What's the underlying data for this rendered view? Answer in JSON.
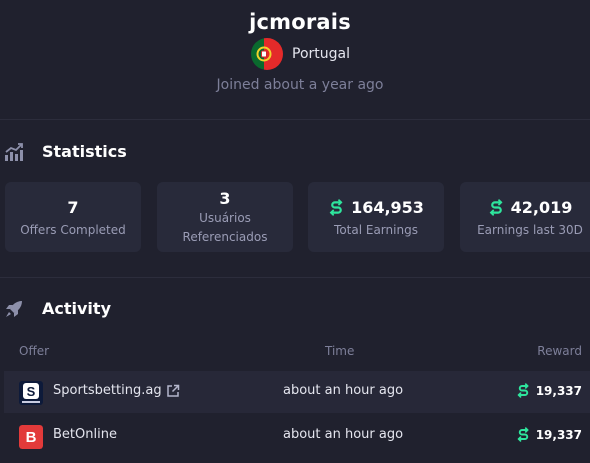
{
  "profile": {
    "username": "jcmorais",
    "country": "Portugal",
    "flag_icon": "portugal-flag-icon",
    "joined": "Joined about a year ago"
  },
  "statistics": {
    "title": "Statistics",
    "icon": "chart-trend-icon",
    "cards": [
      {
        "value": "7",
        "label": "Offers Completed"
      },
      {
        "value": "3",
        "label_line1": "Usuários",
        "label_line2": "Referenciados"
      },
      {
        "value": "164,953",
        "label": "Total Earnings",
        "coin_icon": "coin-icon"
      },
      {
        "value": "42,019",
        "label": "Earnings last 30D",
        "coin_icon": "coin-icon"
      }
    ]
  },
  "activity": {
    "title": "Activity",
    "icon": "rocket-icon",
    "columns": [
      "Offer",
      "Time",
      "Reward"
    ],
    "rows": [
      {
        "offer": "Sportsbetting.ag",
        "logo_icon": "sportsbetting-logo-icon",
        "external_link_icon": "external-link-icon",
        "time": "about an hour ago",
        "reward": "19,337"
      },
      {
        "offer": "BetOnline",
        "logo_icon": "betonline-logo-icon",
        "time": "about an hour ago",
        "reward": "19,337"
      }
    ]
  },
  "colors": {
    "background": "#20212e",
    "card": "#282a3a",
    "accent_green": "#2ee59d",
    "muted_text": "#7d7f99"
  }
}
